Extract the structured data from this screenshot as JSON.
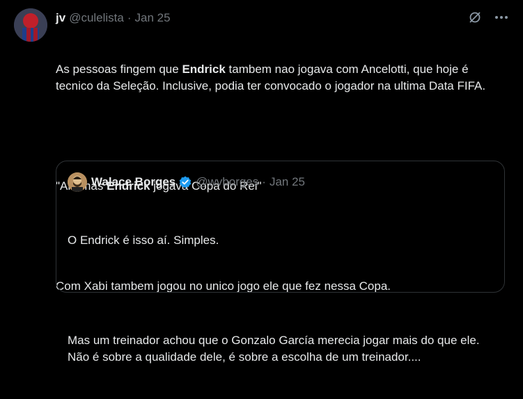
{
  "tweet": {
    "name": "jv",
    "handle": "@culelista",
    "separator": "·",
    "time": "Jan 25",
    "p1_a": "As pessoas fingem que ",
    "p1_bold": "Endrick",
    "p1_b": " tambem nao jogava com Ancelotti, que hoje é tecnico da Seleção. Inclusive, podia ter convocado o jogador na ultima Data FIFA.",
    "p2_a": "\"Ah, mas ",
    "p2_bold": "Endrick",
    "p2_b": " jogava Copa do Rei\"",
    "p3": "Com Xabi tambem jogou no unico jogo ele que fez nessa Copa.",
    "icons": [
      "grok-icon",
      "more-icon"
    ]
  },
  "quote": {
    "name": "Walace Borges",
    "handle": "@wvborges",
    "separator": "·",
    "time": "Jan 25",
    "p1": "O Endrick é isso aí. Simples.",
    "p2": "Mas um treinador achou que o Gonzalo García merecia jogar mais do que ele. Não é sobre a qualidade dele, é sobre a escolha de um treinador....",
    "verified_color": "#1d9bf0"
  },
  "colors": {
    "background": "#000000",
    "text": "#e7e9ea",
    "muted": "#71767b",
    "border": "#2f3336"
  }
}
